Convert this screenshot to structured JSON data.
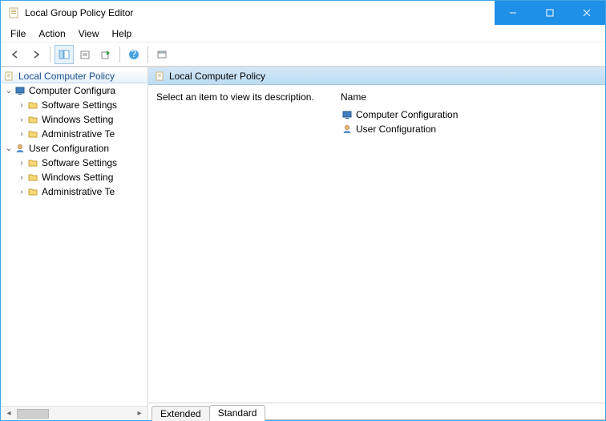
{
  "window": {
    "title": "Local Group Policy Editor"
  },
  "menus": [
    "File",
    "Action",
    "View",
    "Help"
  ],
  "toolbar": {
    "back": "back-icon",
    "forward": "forward-icon",
    "up_pane": "pane-icon",
    "up_pane2": "pane2-icon",
    "props": "props-icon",
    "export": "export-icon",
    "help": "help-icon",
    "extra": "extra-icon"
  },
  "tree": {
    "header": "Local Computer Policy",
    "nodes": {
      "comp": {
        "label": "Computer Configura"
      },
      "comp_sw": {
        "label": "Software Settings"
      },
      "comp_win": {
        "label": "Windows Setting"
      },
      "comp_adm": {
        "label": "Administrative Te"
      },
      "user": {
        "label": "User Configuration"
      },
      "user_sw": {
        "label": "Software Settings"
      },
      "user_win": {
        "label": "Windows Setting"
      },
      "user_adm": {
        "label": "Administrative Te"
      }
    }
  },
  "detail": {
    "header": "Local Computer Policy",
    "description": "Select an item to view its description.",
    "columns": {
      "name": "Name"
    },
    "items": {
      "comp": "Computer Configuration",
      "user": "User Configuration"
    }
  },
  "tabs": {
    "extended": "Extended",
    "standard": "Standard"
  }
}
